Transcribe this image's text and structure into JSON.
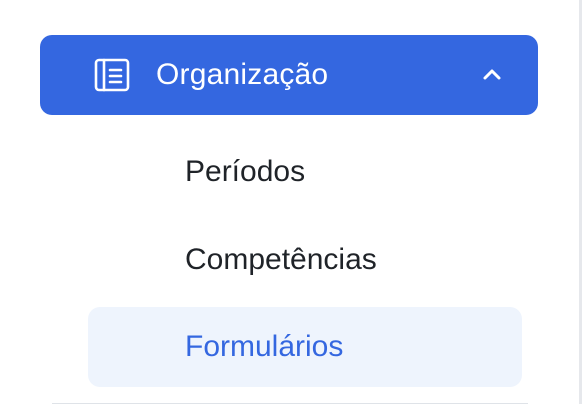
{
  "sidebar": {
    "group": {
      "label": "Organização",
      "icon": "notebook-icon",
      "expanded_icon": "chevron-up-icon",
      "accent_color": "#3467e0"
    },
    "items": [
      {
        "label": "Períodos",
        "active": false
      },
      {
        "label": "Competências",
        "active": false
      },
      {
        "label": "Formulários",
        "active": true
      }
    ],
    "active_bg_color": "#eef4fd",
    "text_color": "#1f2328"
  }
}
